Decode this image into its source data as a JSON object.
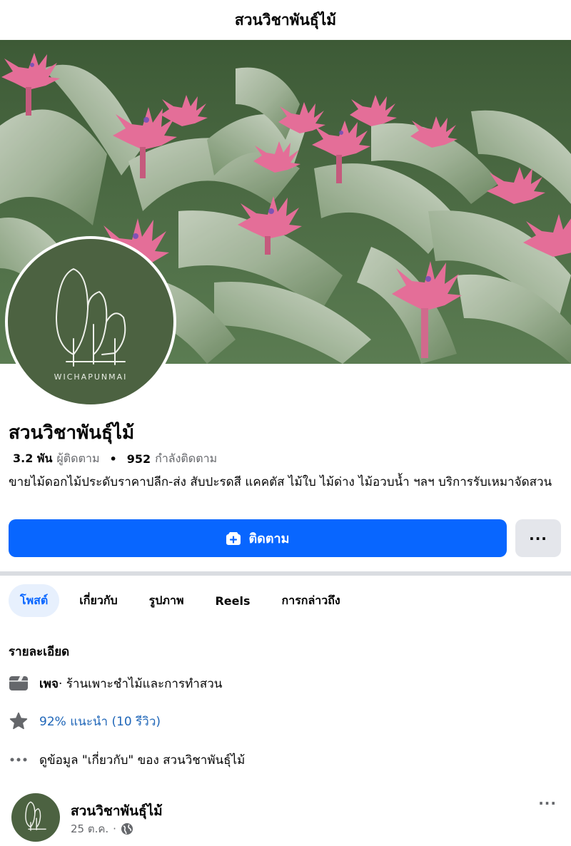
{
  "topbar": {
    "title": "สวนวิชาพันธุ์ไม้"
  },
  "avatar": {
    "brand_text": "WICHAPUNMAI"
  },
  "profile": {
    "name": "สวนวิชาพันธุ์ไม้",
    "followers_count": "3.2 พัน",
    "followers_label": "ผู้ติดตาม",
    "following_count": "952",
    "following_label": "กำลังติดตาม",
    "separator": "•",
    "bio": "ขายไม้ดอกไม้ประดับราคาปลีก-ส่ง สับปะรดสี แคคตัส ไม้ใบ ไม้ด่าง ไม้อวบน้ำ ฯลฯ บริการรับเหมาจัดสวน"
  },
  "actions": {
    "follow_label": "ติดตาม",
    "more_label": "···",
    "follow_color": "#0866ff"
  },
  "tabs": [
    {
      "label": "โพสต์",
      "active": true
    },
    {
      "label": "เกี่ยวกับ",
      "active": false
    },
    {
      "label": "รูปภาพ",
      "active": false
    },
    {
      "label": "Reels",
      "active": false
    },
    {
      "label": "การกล่าวถึง",
      "active": false
    }
  ],
  "details": {
    "title": "รายละเอียด",
    "page_type_label": "เพจ",
    "page_category": " · ร้านเพาะชำไม้และการทำสวน",
    "rating": "92% แนะนำ (10 รีวิว)",
    "about_link": "ดูข้อมูล \"เกี่ยวกับ\" ของ สวนวิชาพันธุ์ไม้",
    "icons": [
      "page-flag-icon",
      "star-icon",
      "more-dots-icon"
    ]
  },
  "post": {
    "author": "สวนวิชาพันธุ์ไม้",
    "date": "25 ต.ค.",
    "dot": "·",
    "more_label": "···",
    "privacy_icon": "globe-icon"
  }
}
